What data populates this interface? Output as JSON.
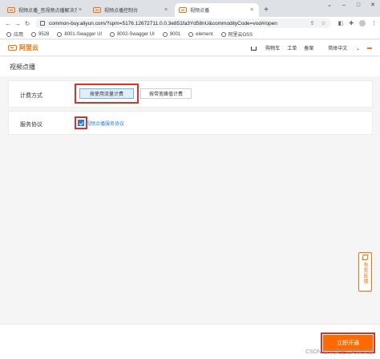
{
  "browser": {
    "tabs": [
      {
        "title": "视频点播_音视频点播解决方案_视频...",
        "active": false
      },
      {
        "title": "视频点播控制台",
        "active": false
      },
      {
        "title": "视频点播",
        "active": true
      }
    ],
    "new_tab": "+",
    "url": "common-buy.aliyun.com/?spm=5176.12672711.0.0.3e851fa3Yd58nU&commodityCode=vod#/open",
    "bookmarks": [
      {
        "label": "应用"
      },
      {
        "label": "9528"
      },
      {
        "label": "8001-Swagger UI"
      },
      {
        "label": "8002-Swagger UI"
      },
      {
        "label": "9001"
      },
      {
        "label": "element"
      },
      {
        "label": "阿里云OSS"
      }
    ]
  },
  "site": {
    "logo": "阿里云",
    "nav": {
      "cart": "购物车",
      "ticket": "工单",
      "record": "备案",
      "lang": "简体中文"
    }
  },
  "page": {
    "title": "视频点播",
    "billing": {
      "label": "计费方式",
      "options": [
        "按使用流量计费",
        "按带宽峰值计费"
      ],
      "selected": "按使用流量计费"
    },
    "agreement": {
      "label": "服务协议",
      "checked": true,
      "link": "视频点播服务协议"
    },
    "feedback": "有奖反馈",
    "open_button": "立即开通",
    "watermark": "CSDN @认真生活的灰太狼"
  },
  "colors": {
    "brand": "#ff6a00",
    "link": "#2f7bd9",
    "highlight": "#d9342b"
  }
}
